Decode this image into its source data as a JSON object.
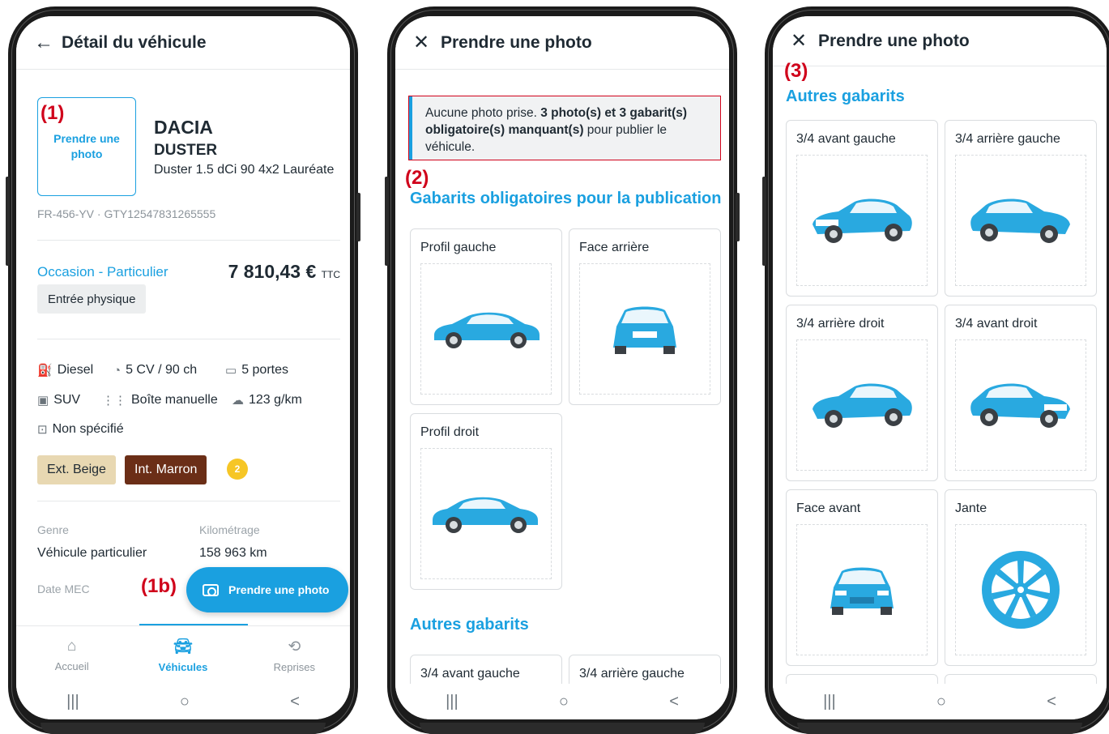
{
  "screen1": {
    "title": "Détail du véhicule",
    "annotation": "(1)",
    "photo_box": "Prendre une photo",
    "make": "DACIA",
    "model": "DUSTER",
    "version": "Duster 1.5 dCi 90 4x2 Lauréate",
    "ids": "FR-456-YV · GTY12547831265555",
    "occasion": "Occasion - Particulier",
    "price": "7 810,43 €",
    "price_unit": "TTC",
    "entry_tag": "Entrée physique",
    "specs": {
      "fuel": "Diesel",
      "power": "5 CV / 90 ch",
      "doors": "5 portes",
      "body": "SUV",
      "gearbox": "Boîte manuelle",
      "co2": "123 g/km",
      "other": "Non spécifié"
    },
    "ext_color": "Ext. Beige",
    "int_color": "Int. Marron",
    "coin_label": "2",
    "genre_label": "Genre",
    "genre_value": "Véhicule particulier",
    "km_label": "Kilométrage",
    "km_value": "158 963 km",
    "date_label": "Date MEC",
    "annotation_1b": "(1b)",
    "fab_label": "Prendre une photo",
    "nav": [
      {
        "label": "Accueil",
        "icon": "home-icon"
      },
      {
        "label": "Véhicules",
        "icon": "car-icon"
      },
      {
        "label": "Reprises",
        "icon": "exchange-icon"
      }
    ]
  },
  "screen2": {
    "title": "Prendre une photo",
    "alert_prefix": "Aucune photo prise. ",
    "alert_bold": "3 photo(s) et 3 gabarit(s) obligatoire(s) manquant(s)",
    "alert_suffix": " pour publier le véhicule.",
    "annotation": "(2)",
    "mandatory_title": "Gabarits obligatoires pour la publication",
    "mandatory": [
      "Profil gauche",
      "Face arrière",
      "Profil droit"
    ],
    "others_title": "Autres gabarits",
    "others": [
      "3/4 avant gauche",
      "3/4 arrière gauche"
    ]
  },
  "screen3": {
    "title": "Prendre une photo",
    "annotation": "(3)",
    "others_title": "Autres gabarits",
    "templates": [
      "3/4 avant gauche",
      "3/4 arrière gauche",
      "3/4 arrière droit",
      "3/4 avant droit",
      "Face avant",
      "Jante"
    ]
  },
  "system_nav": [
    "|||",
    "○",
    "<"
  ],
  "colors": {
    "accent": "#1aa0e0",
    "annotation": "#d0021b",
    "car": "#29a9e0"
  }
}
